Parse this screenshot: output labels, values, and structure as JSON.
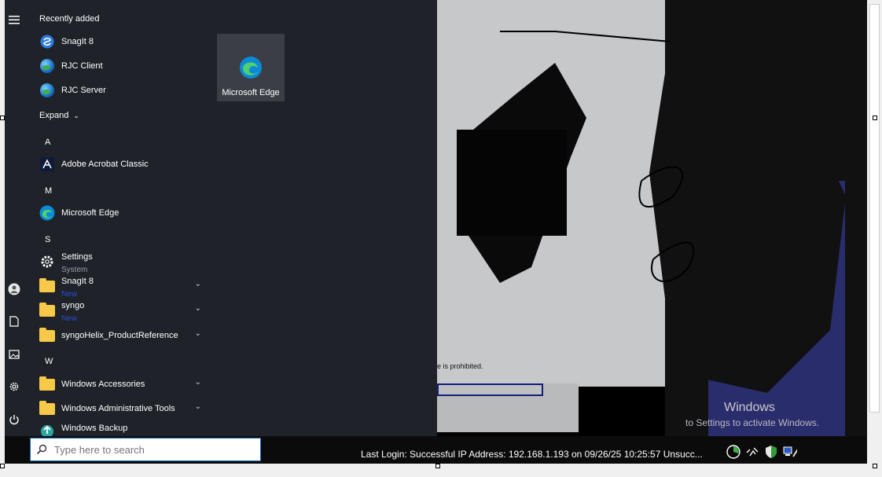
{
  "start_menu": {
    "recently_added_label": "Recently added",
    "recent_items": [
      {
        "label": "SnagIt 8"
      },
      {
        "label": "RJC Client"
      },
      {
        "label": "RJC Server"
      }
    ],
    "expand_label": "Expand",
    "letter_a": "A",
    "letter_m": "M",
    "letter_s": "S",
    "letter_w": "W",
    "apps": {
      "adobe": "Adobe Acrobat Classic",
      "edge": "Microsoft Edge",
      "settings": "Settings",
      "settings_sub": "System",
      "snagit": "SnagIt 8",
      "snagit_new": "New",
      "syngo": "syngo",
      "syngo_new": "New",
      "syngohelix": "syngoHelix_ProductReference",
      "win_accessories": "Windows Accessories",
      "win_admin": "Windows Administrative Tools",
      "win_backup": "Windows Backup"
    },
    "pinned_tile": "Microsoft Edge"
  },
  "background": {
    "prohibited_text": "e is prohibited.",
    "activate_title": "Windows",
    "activate_sub": "to Settings to activate Windows."
  },
  "taskbar": {
    "search_placeholder": "Type here to search",
    "login_text": "Last Login: Successful IP Address: 192.168.1.193 on  09/26/25 10:25:57 Unsucc..."
  }
}
